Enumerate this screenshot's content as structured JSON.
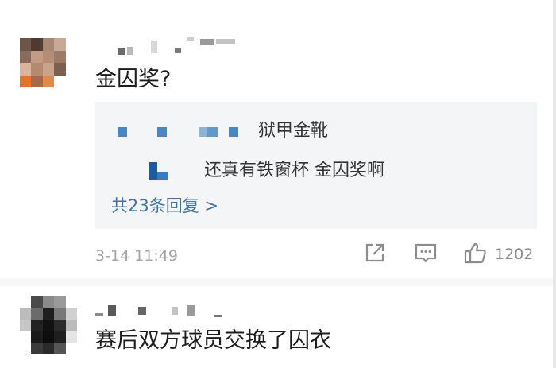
{
  "comments": [
    {
      "text": "金囚奖?",
      "replies": [
        {
          "text": "狱甲金靴"
        },
        {
          "text": "还真有铁窗杯 金囚奖啊"
        }
      ],
      "more_replies": "共23条回复 >",
      "timestamp": "3-14 11:49",
      "share_icon": "share-icon",
      "comment_icon": "comment-icon",
      "like_icon": "thumbs-up-icon",
      "like_count": "1202"
    },
    {
      "text": "赛后双方球员交换了囚衣"
    }
  ],
  "colors": {
    "link": "#3f73a8",
    "reply_bg": "#f4f5f6",
    "meta": "#a5a5a5"
  }
}
